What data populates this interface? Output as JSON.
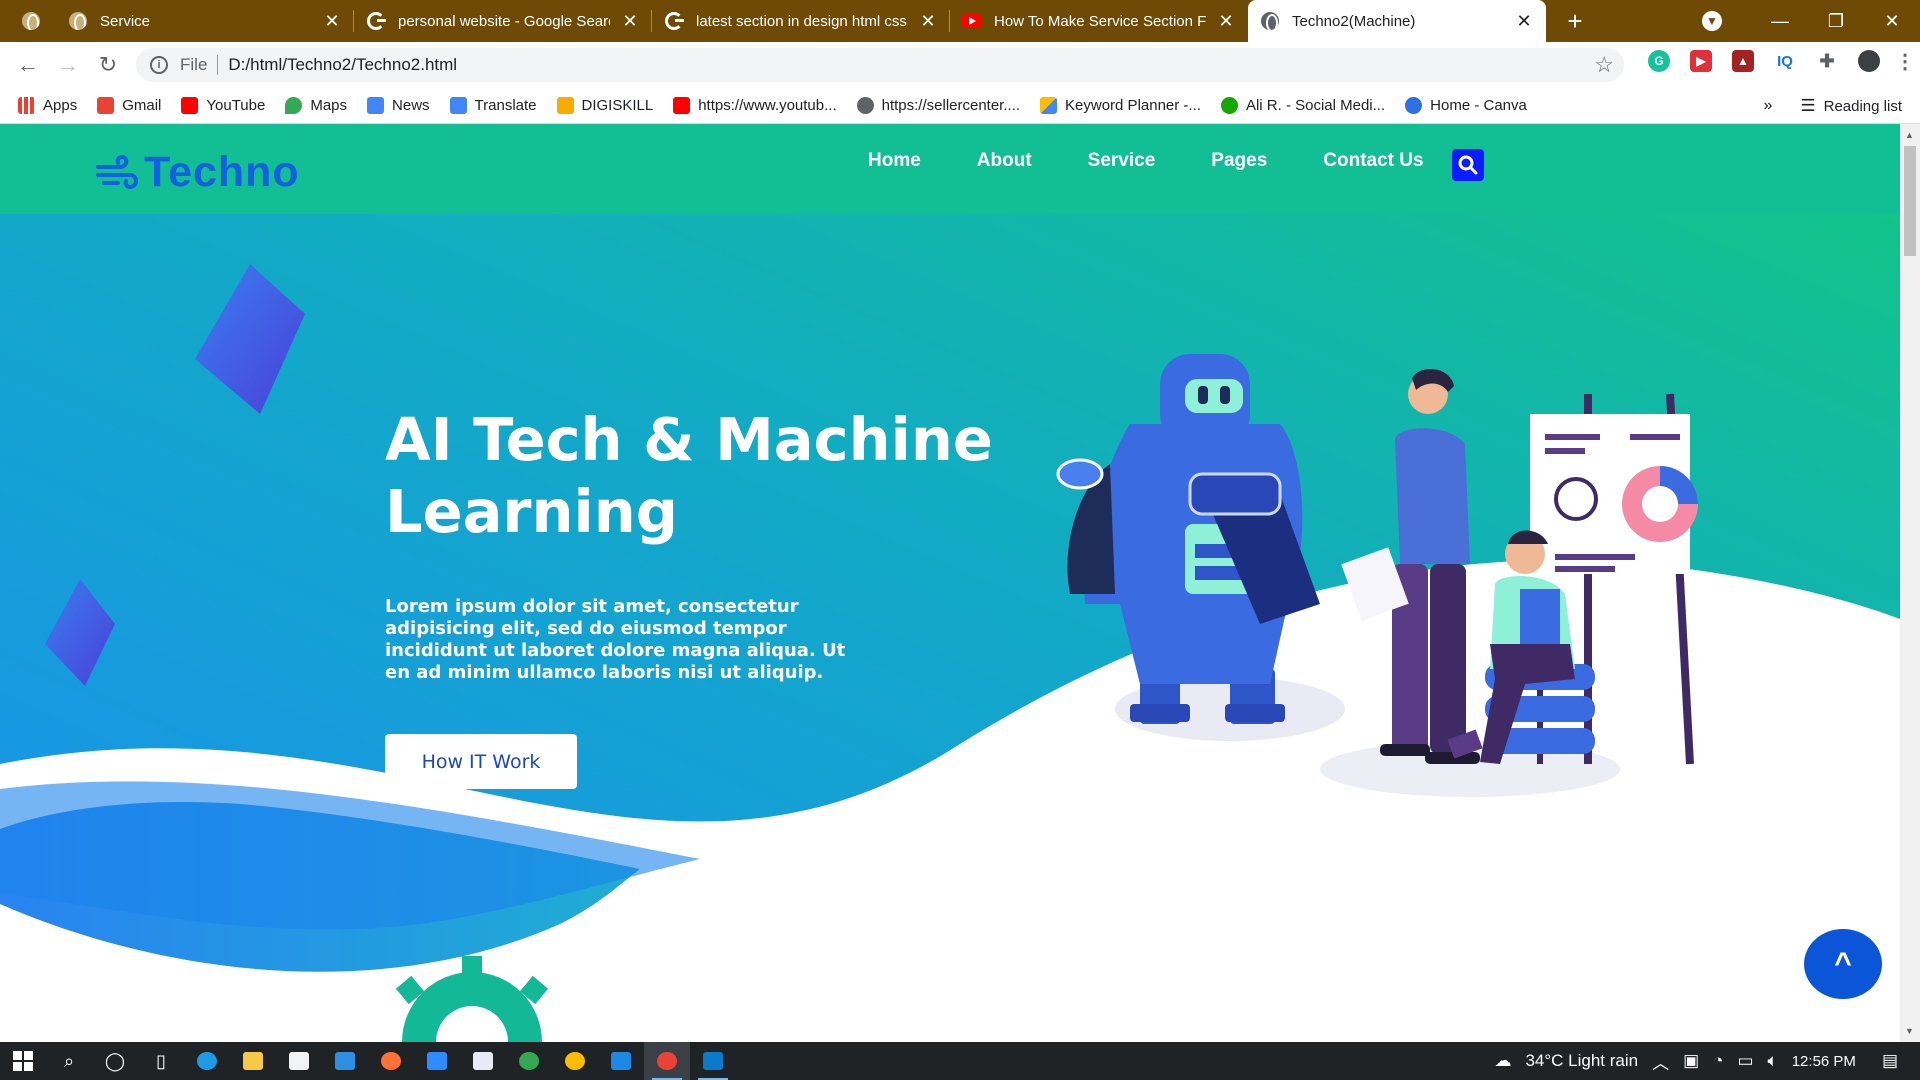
{
  "browser": {
    "tabs": [
      {
        "title": "Service",
        "icon": "globe-icon",
        "active": false
      },
      {
        "title": "personal website - Google Search",
        "icon": "google-icon",
        "active": false
      },
      {
        "title": "latest section in design html css",
        "icon": "google-icon",
        "active": false
      },
      {
        "title": "How To Make Service Section For",
        "icon": "youtube-icon",
        "active": false
      },
      {
        "title": "Techno2(Machine)",
        "icon": "globe-icon",
        "active": true
      }
    ],
    "address": {
      "scheme_label": "File",
      "url": "D:/html/Techno2/Techno2.html"
    },
    "bookmarks": [
      {
        "label": "Apps",
        "color": "#4285f4"
      },
      {
        "label": "Gmail",
        "color": "#ea4335"
      },
      {
        "label": "YouTube",
        "color": "#ff0000"
      },
      {
        "label": "Maps",
        "color": "#34a853"
      },
      {
        "label": "News",
        "color": "#4285f4"
      },
      {
        "label": "Translate",
        "color": "#4285f4"
      },
      {
        "label": "DIGISKILL",
        "color": "#f9ab00"
      },
      {
        "label": "https://www.youtub...",
        "color": "#ff0000"
      },
      {
        "label": "https://sellercenter....",
        "color": "#5f6368"
      },
      {
        "label": "Keyword Planner -...",
        "color": "#fbbc04"
      },
      {
        "label": "Ali R. - Social Medi...",
        "color": "#14a800"
      },
      {
        "label": "Home - Canva",
        "color": "#2f6fe4"
      }
    ],
    "reading_list": "Reading list",
    "more_bookmarks": "»"
  },
  "site": {
    "logo_text": "Techno",
    "nav": [
      "Home",
      "About",
      "Service",
      "Pages",
      "Contact Us"
    ],
    "hero": {
      "title": "AI Tech & Machine Learning",
      "body": "Lorem ipsum dolor sit amet, consectetur adipisicing elit, sed do eiusmod tempor incididunt ut laboret dolore magna aliqua. Ut en ad minim ullamco laboris nisi ut aliquip.",
      "cta_label": "How IT Work"
    },
    "scroll_top_label": "^",
    "colors": {
      "nav_bg": "#12bf95",
      "hero_start": "#1a8ff0",
      "hero_end": "#12c38a",
      "logo": "#1560e0",
      "search_btn": "#0d1bff",
      "scroll_btn": "#0b55d9"
    }
  },
  "taskbar": {
    "weather": "34°C  Light rain",
    "time": "12:56 PM"
  }
}
